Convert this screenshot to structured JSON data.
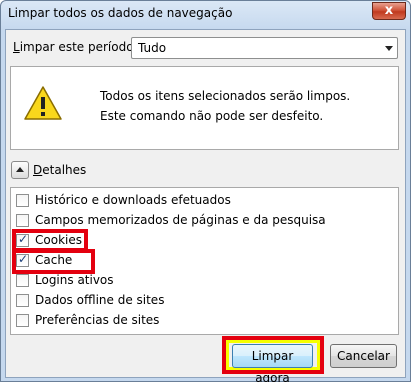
{
  "window": {
    "title": "Limpar todos os dados de navegação",
    "close_label": "x"
  },
  "period": {
    "label_pre": "L",
    "label_rest": "impar este período:",
    "value": "Tudo"
  },
  "warning": {
    "line1": "Todos os itens selecionados serão limpos.",
    "line2": "Este comando não pode ser desfeito."
  },
  "details": {
    "label_pre": "D",
    "label_rest": "etalhes"
  },
  "items": [
    {
      "label": "Histórico e downloads efetuados",
      "checked": false
    },
    {
      "label": "Campos memorizados de páginas e da pesquisa",
      "checked": false
    },
    {
      "label": "Cookies",
      "checked": true
    },
    {
      "label": "Cache",
      "checked": true
    },
    {
      "label": "Logins ativos",
      "checked": false
    },
    {
      "label": "Dados offline de sites",
      "checked": false
    },
    {
      "label": "Preferências de sites",
      "checked": false
    }
  ],
  "buttons": {
    "clear_now": "Limpar agora",
    "cancel": "Cancelar"
  },
  "colors": {
    "highlight_red": "#e4000f",
    "highlight_yellow": "#f6ff00"
  }
}
